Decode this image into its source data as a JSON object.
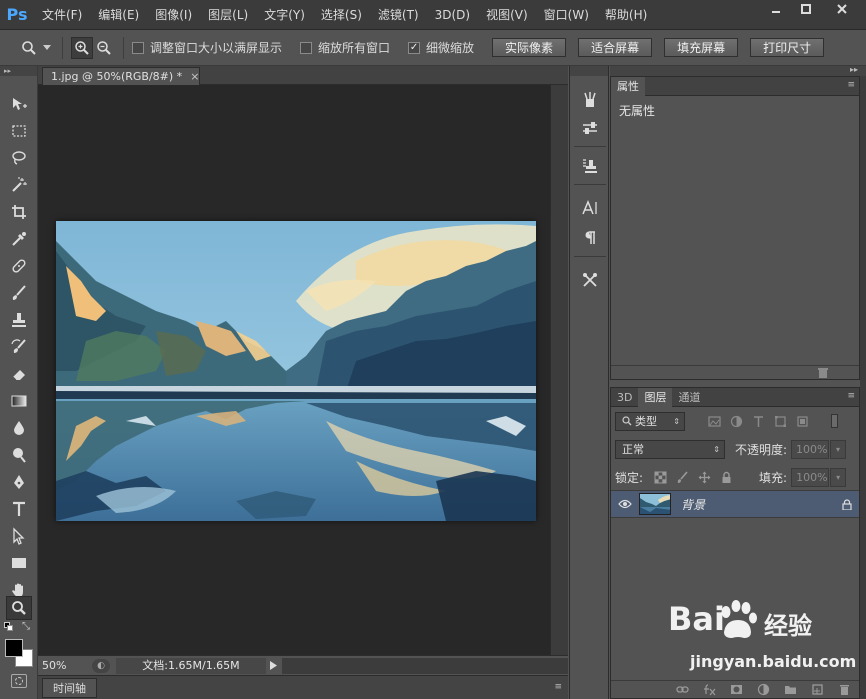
{
  "app": {
    "logo": "Ps"
  },
  "menu": [
    "文件(F)",
    "编辑(E)",
    "图像(I)",
    "图层(L)",
    "文字(Y)",
    "选择(S)",
    "滤镜(T)",
    "3D(D)",
    "视图(V)",
    "窗口(W)",
    "帮助(H)"
  ],
  "options": {
    "check1": {
      "label": "调整窗口大小以满屏显示",
      "checked": false
    },
    "check2": {
      "label": "缩放所有窗口",
      "checked": false
    },
    "check3": {
      "label": "细微缩放",
      "checked": true,
      "mark": "✓"
    },
    "buttons": [
      "实际像素",
      "适合屏幕",
      "填充屏幕",
      "打印尺寸"
    ]
  },
  "document": {
    "tab_title": "1.jpg @ 50%(RGB/8#) *",
    "close": "×",
    "zoom": "50%",
    "doc_size": "文档:1.65M/1.65M"
  },
  "timeline": {
    "label": "时间轴"
  },
  "properties": {
    "tab": "属性",
    "body": "无属性"
  },
  "layers": {
    "tabs": [
      "3D",
      "图层",
      "通道"
    ],
    "filter_kind": "类型",
    "blend_mode": "正常",
    "opacity_label": "不透明度:",
    "opacity_value": "100%",
    "lock_label": "锁定:",
    "fill_label": "填充:",
    "fill_value": "100%",
    "layer_name": "背景"
  },
  "watermark": {
    "brand": "Bai",
    "brand_cn": "经验",
    "url": "jingyan.baidu.com"
  },
  "colors": {
    "foreground": "#000000",
    "background": "#ffffff",
    "selected_layer": "#4d5c73",
    "logo": "#4aa8ff"
  }
}
